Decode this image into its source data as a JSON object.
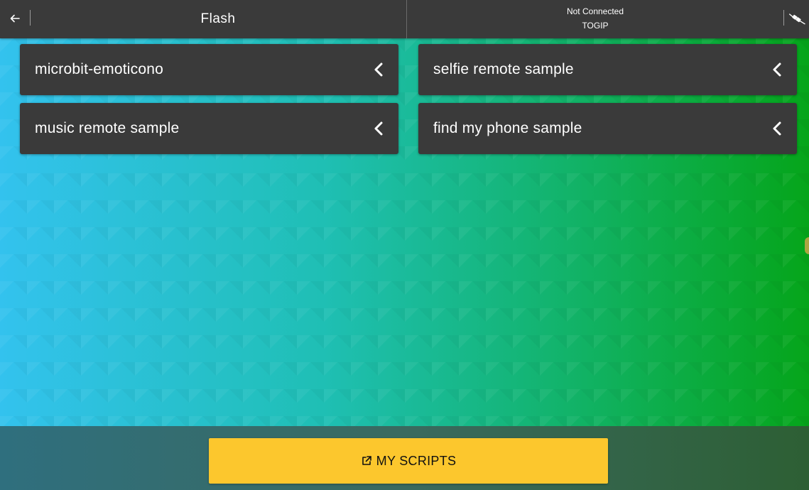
{
  "topbar": {
    "title": "Flash",
    "connection_status": "Not Connected",
    "device_name": "TOGIP"
  },
  "icons": {
    "back": "arrow-left-icon",
    "plug": "plug-icon",
    "chevron": "chevron-left-icon",
    "external_link": "external-link-icon"
  },
  "cards": [
    {
      "label": "microbit-emoticono"
    },
    {
      "label": "selfie remote sample"
    },
    {
      "label": "music remote sample"
    },
    {
      "label": "find my phone sample"
    }
  ],
  "bottom": {
    "my_scripts_label": "MY SCRIPTS"
  },
  "colors": {
    "bar": "#3a3a3a",
    "accent_button": "#fcc72d",
    "bg_left": "#33c2ee",
    "bg_right": "#05a51a"
  }
}
